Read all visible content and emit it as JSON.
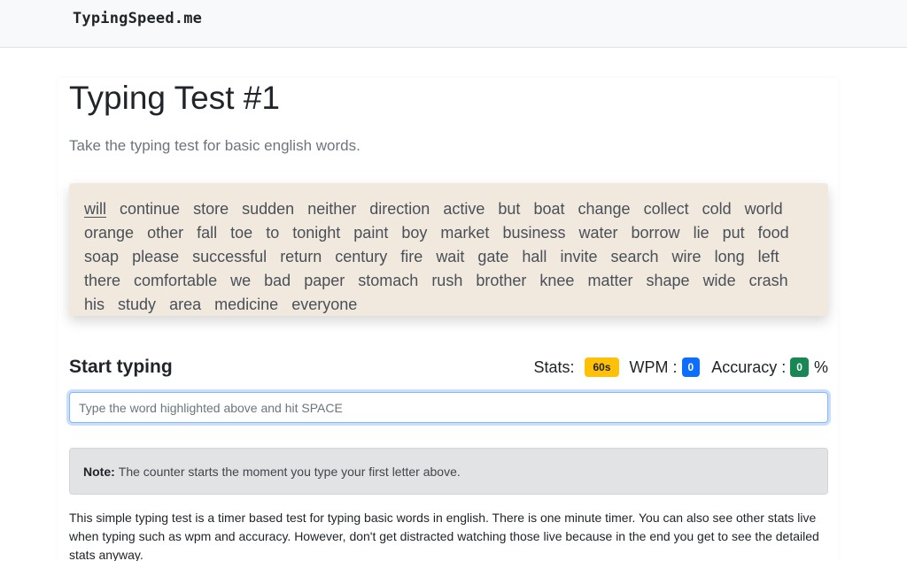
{
  "navbar": {
    "brand": "TypingSpeed.me"
  },
  "header": {
    "title": "Typing Test #1",
    "lead": "Take the typing test for basic english words."
  },
  "words": {
    "current": "will",
    "list": [
      "will",
      "continue",
      "store",
      "sudden",
      "neither",
      "direction",
      "active",
      "but",
      "boat",
      "change",
      "collect",
      "cold",
      "world",
      "orange",
      "other",
      "fall",
      "toe",
      "to",
      "tonight",
      "paint",
      "boy",
      "market",
      "business",
      "water",
      "borrow",
      "lie",
      "put",
      "food",
      "soap",
      "please",
      "successful",
      "return",
      "century",
      "fire",
      "wait",
      "gate",
      "hall",
      "invite",
      "search",
      "wire",
      "long",
      "left",
      "there",
      "comfortable",
      "we",
      "bad",
      "paper",
      "stomach",
      "rush",
      "brother",
      "knee",
      "matter",
      "shape",
      "wide",
      "crash",
      "his",
      "study",
      "area",
      "medicine",
      "everyone"
    ]
  },
  "typing": {
    "label": "Start typing",
    "input_placeholder": "Type the word highlighted above and hit SPACE",
    "input_value": ""
  },
  "stats": {
    "label": "Stats:",
    "timer": "60s",
    "wpm_label": "WPM",
    "wpm_value": "0",
    "accuracy_label": "Accuracy",
    "accuracy_value": "0",
    "accuracy_unit": "%",
    "colon": ":"
  },
  "note": {
    "bold": "Note:",
    "text": "The counter starts the moment you type your first letter above."
  },
  "description": "This simple typing test is a timer based test for typing basic words in english. There is one minute timer. You can also see other stats live when typing such as wpm and accuracy. However, don't get distracted watching those live because in the end you get to see the detailed stats anyway.",
  "colors": {
    "timer_badge": "#ffc107",
    "wpm_badge": "#0d6efd",
    "accuracy_badge": "#198754",
    "words_box_bg": "#f1e8de"
  }
}
